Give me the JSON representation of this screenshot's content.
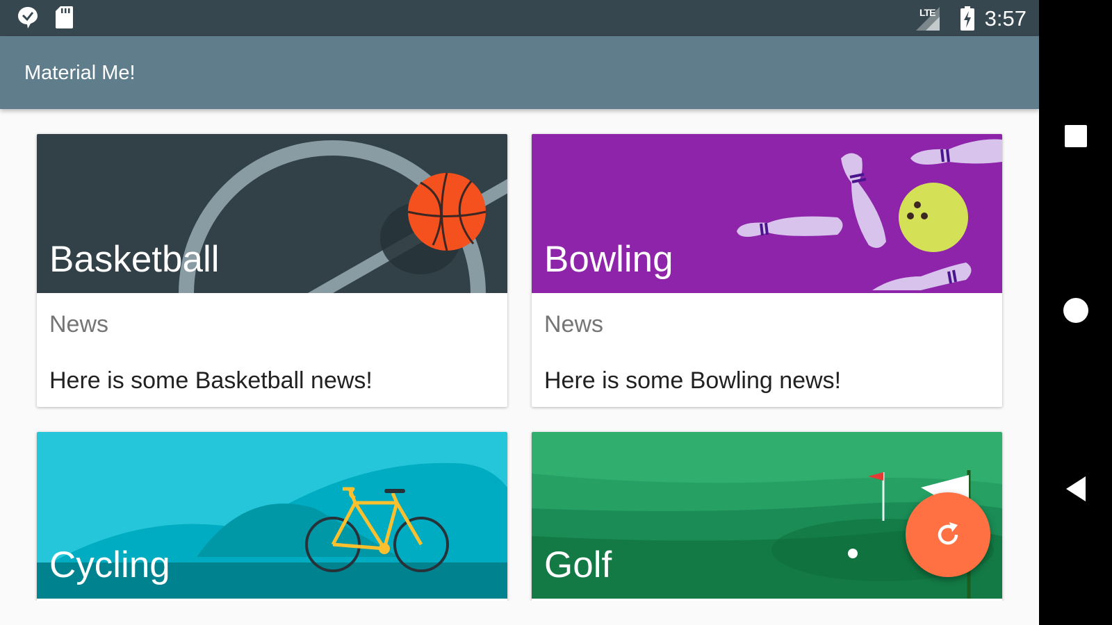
{
  "status_bar": {
    "time": "3:57",
    "network": "LTE",
    "icons": [
      "notification-icon",
      "sd-card-icon",
      "signal-icon",
      "battery-charging-icon"
    ]
  },
  "app_bar": {
    "title": "Material Me!"
  },
  "cards": [
    {
      "title": "Basketball",
      "subtitle": "News",
      "text": "Here is some Basketball news!"
    },
    {
      "title": "Bowling",
      "subtitle": "News",
      "text": "Here is some Bowling news!"
    },
    {
      "title": "Cycling"
    },
    {
      "title": "Golf"
    }
  ],
  "fab": {
    "icon": "refresh-icon",
    "color": "#ff7043"
  },
  "nav_bar": {
    "buttons": [
      "recents-button",
      "home-button",
      "back-button"
    ]
  },
  "colors": {
    "status_bar": "#37474f",
    "app_bar": "#607d8b",
    "basketball": "#324147",
    "bowling": "#8e24aa",
    "cycling": "#26c6da",
    "golf": "#2fae6e"
  }
}
